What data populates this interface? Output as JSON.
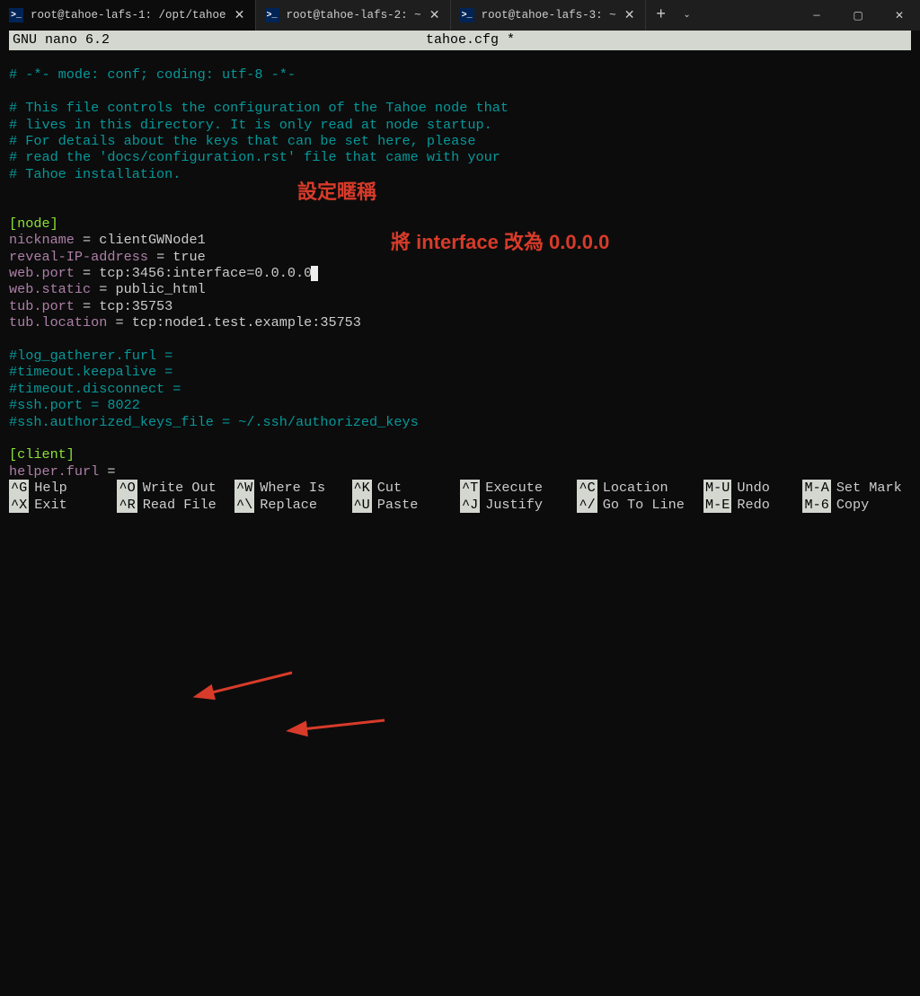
{
  "tabs": [
    {
      "title": "root@tahoe-lafs-1: /opt/tahoe",
      "active": true
    },
    {
      "title": "root@tahoe-lafs-2: ~",
      "active": false
    },
    {
      "title": "root@tahoe-lafs-3: ~",
      "active": false
    }
  ],
  "nano": {
    "version": "GNU nano 6.2",
    "filename": "tahoe.cfg *"
  },
  "lines": {
    "modeline": "# -*- mode: conf; coding: utf-8 -*-",
    "hdr1": "# This file controls the configuration of the Tahoe node that",
    "hdr2": "# lives in this directory. It is only read at node startup.",
    "hdr3": "# For details about the keys that can be set here, please",
    "hdr4": "# read the 'docs/configuration.rst' file that came with your",
    "hdr5": "# Tahoe installation.",
    "sec_node": "[node]",
    "nick_key": "nickname",
    "nick_val": " = clientGWNode1",
    "rev_key": "reveal-IP-address",
    "rev_val": " = true",
    "wp_key": "web.port",
    "wp_val": " = tcp:3456:interface=0.0.0.0",
    "ws_key": "web.static",
    "ws_val": " = public_html",
    "tp_key": "tub.port",
    "tp_val": " = tcp:35753",
    "tl_key": "tub.location",
    "tl_val": " = tcp:node1.test.example:35753",
    "c1": "#log_gatherer.furl =",
    "c2": "#timeout.keepalive =",
    "c3": "#timeout.disconnect =",
    "c4": "#ssh.port = 8022",
    "c5": "#ssh.authorized_keys_file = ~/.ssh/authorized_keys",
    "sec_client": "[client]",
    "hf_key": "helper.furl",
    "hf_val": " ="
  },
  "annotations": {
    "nickname": "設定暱稱",
    "interface": "將 interface 改為 0.0.0.0"
  },
  "shortcuts": [
    [
      {
        "k": "^G",
        "d": "Help"
      },
      {
        "k": "^X",
        "d": "Exit"
      }
    ],
    [
      {
        "k": "^O",
        "d": "Write Out"
      },
      {
        "k": "^R",
        "d": "Read File"
      }
    ],
    [
      {
        "k": "^W",
        "d": "Where Is"
      },
      {
        "k": "^\\",
        "d": "Replace"
      }
    ],
    [
      {
        "k": "^K",
        "d": "Cut"
      },
      {
        "k": "^U",
        "d": "Paste"
      }
    ],
    [
      {
        "k": "^T",
        "d": "Execute"
      },
      {
        "k": "^J",
        "d": "Justify"
      }
    ],
    [
      {
        "k": "^C",
        "d": "Location"
      },
      {
        "k": "^/",
        "d": "Go To Line"
      }
    ],
    [
      {
        "k": "M-U",
        "d": "Undo"
      },
      {
        "k": "M-E",
        "d": "Redo"
      }
    ],
    [
      {
        "k": "M-A",
        "d": "Set Mark"
      },
      {
        "k": "M-6",
        "d": "Copy"
      }
    ]
  ]
}
